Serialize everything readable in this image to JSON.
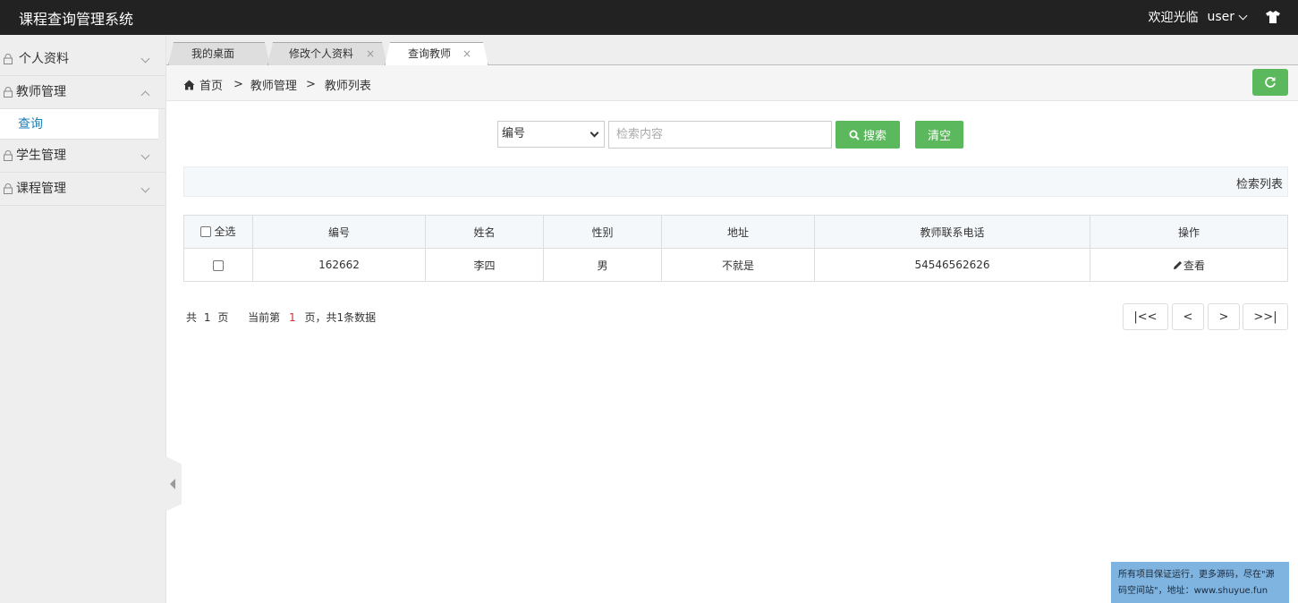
{
  "app": {
    "title": "课程查询管理系统"
  },
  "header": {
    "welcome": "欢迎光临",
    "user": "user",
    "shirt_icon": "tshirt-icon"
  },
  "sidebar": {
    "items": [
      {
        "label": "个人资料",
        "expanded": false
      },
      {
        "label": "教师管理",
        "expanded": true,
        "children": [
          {
            "label": "查询"
          }
        ]
      },
      {
        "label": "学生管理",
        "expanded": false
      },
      {
        "label": "课程管理",
        "expanded": false
      }
    ]
  },
  "tabs": [
    {
      "label": "我的桌面",
      "closable": false
    },
    {
      "label": "修改个人资料",
      "closable": true
    },
    {
      "label": "查询教师",
      "closable": true,
      "active": true
    }
  ],
  "tab_close_glyph": "×",
  "breadcrumb": {
    "home": "首页",
    "sep": ">",
    "level1": "教师管理",
    "level2": "教师列表"
  },
  "search": {
    "field_selected": "编号",
    "placeholder": "检索内容",
    "search_label": "搜索",
    "clear_label": "清空"
  },
  "list_title": "检索列表",
  "table": {
    "select_all": "全选",
    "columns": [
      "编号",
      "姓名",
      "性别",
      "地址",
      "教师联系电话",
      "操作"
    ],
    "rows": [
      {
        "id": "162662",
        "name": "李四",
        "gender": "男",
        "address": "不就是",
        "phone": "54546562626",
        "action": "查看"
      }
    ]
  },
  "pagination": {
    "total_pages_prefix": "共",
    "total_pages": "1",
    "total_pages_suffix": "页",
    "current_prefix": "当前第",
    "current": "1",
    "current_suffix": "页，共1条数据",
    "first": "|<<",
    "prev": "<",
    "next": ">",
    "last": ">>|"
  },
  "note": "所有项目保证运行，更多源码，尽在\"源码空间站\"，地址：www.shuyue.fun",
  "colors": {
    "header_bg": "#222222",
    "accent_green": "#5cb85c",
    "link_blue": "#1e7fb8",
    "note_bg": "#7fb3e0"
  }
}
